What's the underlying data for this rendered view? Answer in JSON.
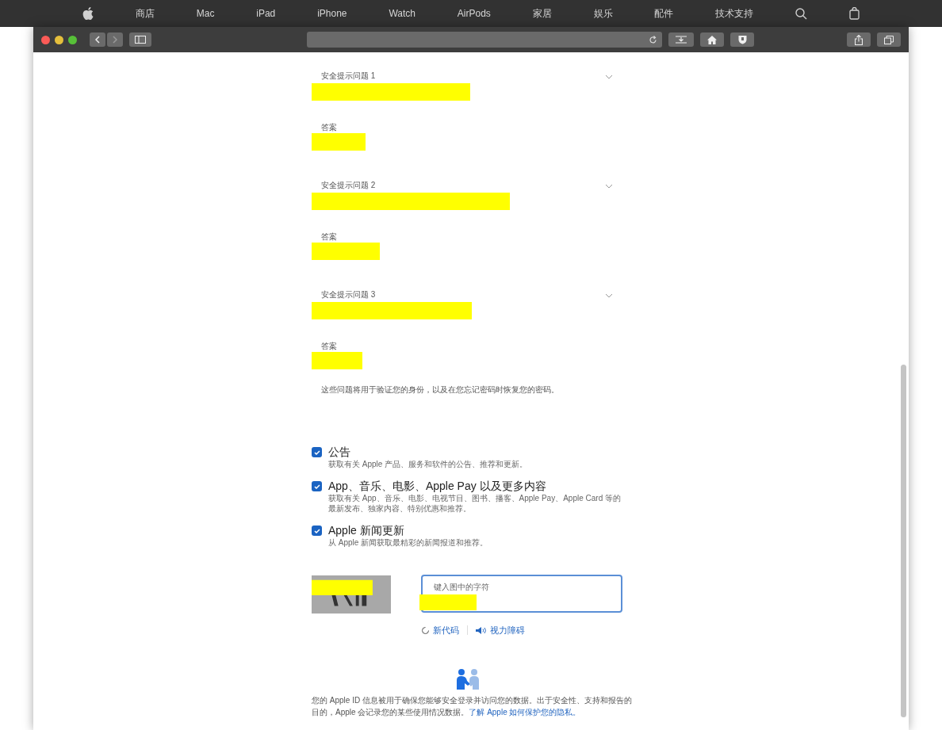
{
  "global_nav": {
    "items": [
      {
        "kind": "logo"
      },
      {
        "kind": "text",
        "label": "商店"
      },
      {
        "kind": "text",
        "label": "Mac"
      },
      {
        "kind": "text",
        "label": "iPad"
      },
      {
        "kind": "text",
        "label": "iPhone"
      },
      {
        "kind": "text",
        "label": "Watch"
      },
      {
        "kind": "text",
        "label": "AirPods"
      },
      {
        "kind": "text",
        "label": "家居"
      },
      {
        "kind": "text",
        "label": "娱乐"
      },
      {
        "kind": "text",
        "label": "配件"
      },
      {
        "kind": "text",
        "label": "技术支持"
      },
      {
        "kind": "search"
      },
      {
        "kind": "bag"
      }
    ]
  },
  "security_questions": [
    {
      "label": "安全提示问题 1",
      "answer_label": "答案"
    },
    {
      "label": "安全提示问题 2",
      "answer_label": "答案"
    },
    {
      "label": "安全提示问题 3",
      "answer_label": "答案"
    }
  ],
  "questions_note": "这些问题将用于验证您的身份，以及在您忘记密码时恢复您的密码。",
  "subscriptions": [
    {
      "title": "公告",
      "description": "获取有关 Apple 产品、服务和软件的公告、推荐和更新。",
      "checked": true
    },
    {
      "title": "App、音乐、电影、Apple Pay 以及更多内容",
      "description": "获取有关 App、音乐、电影、电视节目、图书、播客、Apple Pay、Apple Card 等的最新发布、独家内容、特别优惠和推荐。",
      "checked": true
    },
    {
      "title": "Apple 新闻更新",
      "description": "从 Apple 新闻获取最精彩的新闻报道和推荐。",
      "checked": true
    }
  ],
  "captcha": {
    "placeholder": "键入图中的字符",
    "new_code": "新代码",
    "vision_impaired": "视力障碍"
  },
  "privacy": {
    "text": "您的 Apple ID 信息被用于确保您能够安全登录并访问您的数据。出于安全性、支持和报告的目的，Apple 会记录您的某些使用情况数据。",
    "link": "了解 Apple 如何保护您的隐私。"
  }
}
